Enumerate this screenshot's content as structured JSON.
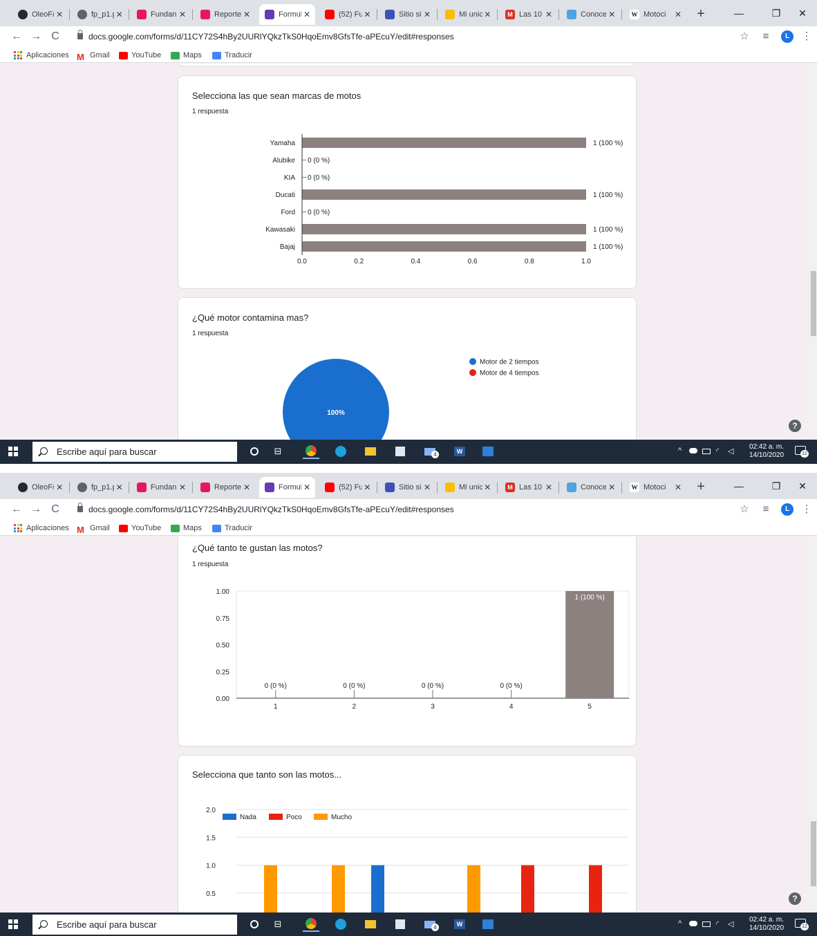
{
  "browser": {
    "tabs": [
      {
        "title": "OleoF/",
        "icon": "github-icon",
        "color": "#24292e"
      },
      {
        "title": "fp_p1.p",
        "icon": "globe-icon",
        "color": "#5f6368"
      },
      {
        "title": "Fundan",
        "icon": "slides-icon",
        "color": "#e8175d"
      },
      {
        "title": "Reporte",
        "icon": "slides-icon",
        "color": "#e8175d"
      },
      {
        "title": "Formul",
        "icon": "forms-icon",
        "color": "#673ab7"
      },
      {
        "title": "(52) Fu",
        "icon": "youtube-icon",
        "color": "#ff0000"
      },
      {
        "title": "Sitio si",
        "icon": "sites-icon",
        "color": "#3f51b5"
      },
      {
        "title": "Mi unic",
        "icon": "drive-icon",
        "color": "#fbbc04"
      },
      {
        "title": "Las 10",
        "icon": "m-icon",
        "color": "#d93025"
      },
      {
        "title": "Conoce",
        "icon": "cloud-icon",
        "color": "#4fa3e0"
      },
      {
        "title": "Motoci",
        "icon": "wikipedia-icon",
        "color": "#ffffff"
      }
    ],
    "tab_close": "✕",
    "new_tab": "+",
    "url": "docs.google.com/forms/d/11CY72S4hBy2UURlYQkzTkS0HqoEmv8GfsTfe-aPEcuY/edit#responses",
    "avatar_letter": "L",
    "bookmarks": [
      "Aplicaciones",
      "Gmail",
      "YouTube",
      "Maps",
      "Traducir"
    ]
  },
  "q1": {
    "title": "Selecciona las que sean marcas de motos",
    "responses": "1 respuesta",
    "chart_data": {
      "type": "bar",
      "orientation": "horizontal",
      "categories": [
        "Yamaha",
        "Alubike",
        "KIA",
        "Ducati",
        "Ford",
        "Kawasaki",
        "Bajaj"
      ],
      "values": [
        1,
        0,
        0,
        1,
        0,
        1,
        1
      ],
      "labels": [
        "1 (100 %)",
        "0 (0 %)",
        "0 (0 %)",
        "1 (100 %)",
        "0 (0 %)",
        "1 (100 %)",
        "1 (100 %)"
      ],
      "xlim": [
        0,
        1
      ],
      "xticks": [
        "0.0",
        "0.2",
        "0.4",
        "0.6",
        "0.8",
        "1.0"
      ],
      "bar_color": "#8d8180"
    }
  },
  "q2": {
    "title": "¿Qué motor contamina mas?",
    "responses": "1 respuesta",
    "chart_data": {
      "type": "pie",
      "labels": [
        "Motor de 2 tiempos",
        "Motor de 4 tiempos"
      ],
      "values": [
        1,
        0
      ],
      "colors": [
        "#1a6fce",
        "#e8230f"
      ],
      "slice_label": "100%"
    }
  },
  "q3": {
    "title": "¿Qué tanto te gustan las motos?",
    "responses": "1 respuesta",
    "chart_data": {
      "type": "bar",
      "categories": [
        "1",
        "2",
        "3",
        "4",
        "5"
      ],
      "values": [
        0,
        0,
        0,
        0,
        1
      ],
      "labels": [
        "0 (0 %)",
        "0 (0 %)",
        "0 (0 %)",
        "0 (0 %)",
        "1 (100 %)"
      ],
      "ylim": [
        0,
        1
      ],
      "yticks": [
        "0.00",
        "0.25",
        "0.50",
        "0.75",
        "1.00"
      ],
      "bar_color": "#8d8180"
    }
  },
  "q4": {
    "title": "Selecciona que tanto son las motos...",
    "chart_data": {
      "type": "bar",
      "series": [
        {
          "name": "Nada",
          "color": "#1a6fce"
        },
        {
          "name": "Poco",
          "color": "#e8230f"
        },
        {
          "name": "Mucho",
          "color": "#ff9900"
        }
      ],
      "visible_bars": [
        {
          "series": "Mucho",
          "value": 1
        },
        {
          "series": "Mucho",
          "value": 1
        },
        {
          "series": "Nada",
          "value": 1
        },
        {
          "series": "Mucho",
          "value": 1
        },
        {
          "series": "Poco",
          "value": 1
        },
        {
          "series": "Poco",
          "value": 1
        }
      ],
      "ylim": [
        0,
        2
      ],
      "yticks": [
        "0.5",
        "1.0",
        "1.5",
        "2.0"
      ]
    }
  },
  "taskbar": {
    "search_placeholder": "Escribe aquí para buscar",
    "time": "02:42 a. m.",
    "date": "14/10/2020",
    "notifications": "12",
    "mail_badge": "4"
  },
  "help_label": "?"
}
